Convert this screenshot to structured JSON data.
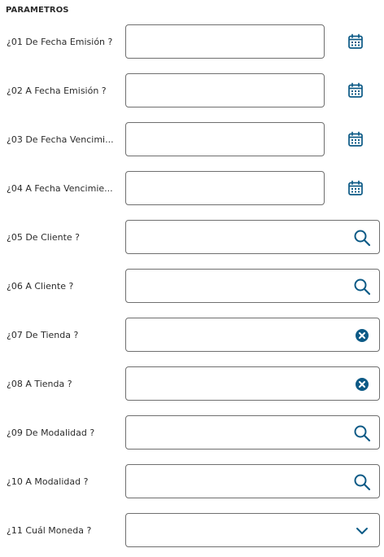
{
  "section": {
    "title": "PARAMETROS"
  },
  "params": [
    {
      "label": "¿01 De Fecha Emisión ?",
      "value": "",
      "icon": "calendar-icon"
    },
    {
      "label": "¿02 A Fecha Emisión ?",
      "value": "",
      "icon": "calendar-icon"
    },
    {
      "label": "¿03 De Fecha Vencimi...",
      "value": "",
      "icon": "calendar-icon"
    },
    {
      "label": "¿04 A Fecha Vencimie...",
      "value": "",
      "icon": "calendar-icon"
    },
    {
      "label": "¿05 De Cliente ?",
      "value": "",
      "icon": "search-icon"
    },
    {
      "label": "¿06 A Cliente ?",
      "value": "",
      "icon": "search-icon"
    },
    {
      "label": "¿07 De Tienda ?",
      "value": "",
      "icon": "clear-icon"
    },
    {
      "label": "¿08 A Tienda ?",
      "value": "",
      "icon": "clear-icon"
    },
    {
      "label": "¿09 De Modalidad ?",
      "value": "",
      "icon": "search-icon"
    },
    {
      "label": "¿10 A Modalidad ?",
      "value": "",
      "icon": "search-icon"
    },
    {
      "label": "¿11 Cuál Moneda ?",
      "value": "",
      "icon": "chevron-down-icon"
    }
  ],
  "colors": {
    "accent": "#0c5a86",
    "border": "#6f6f6f",
    "text": "#2b2b2b"
  }
}
